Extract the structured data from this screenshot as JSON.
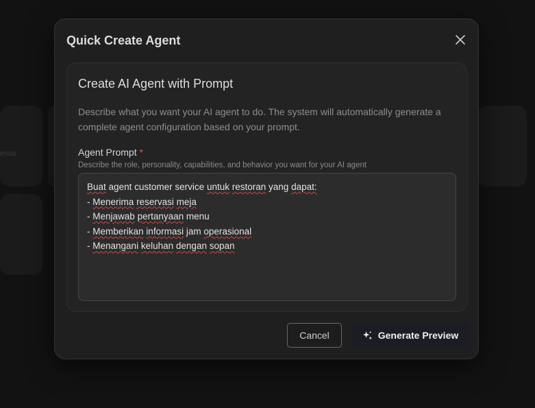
{
  "background": {
    "card_fragment_text": "essa"
  },
  "dialog": {
    "title": "Quick Create Agent",
    "close_icon": "close-icon",
    "panel": {
      "title": "Create AI Agent with Prompt",
      "description": "Describe what you want your AI agent to do. The system will automatically generate a complete agent configuration based on your prompt.",
      "field": {
        "label": "Agent Prompt",
        "required_marker": "*",
        "help": "Describe the role, personality, capabilities, and behavior you want for your AI agent",
        "value_lines": [
          "Buat agent customer service untuk restoran yang dapat:",
          "- Menerima reservasi meja",
          "- Menjawab pertanyaan menu",
          "- Memberikan informasi jam operasional",
          "- Menangani keluhan dengan sopan"
        ]
      }
    },
    "buttons": {
      "cancel_label": "Cancel",
      "generate_label": "Generate Preview",
      "generate_icon": "sparkles-icon"
    }
  },
  "colors": {
    "dialog_bg": "#1f1f1f",
    "panel_bg": "#232323",
    "required": "#e05555",
    "spellcheck": "#d04848"
  }
}
